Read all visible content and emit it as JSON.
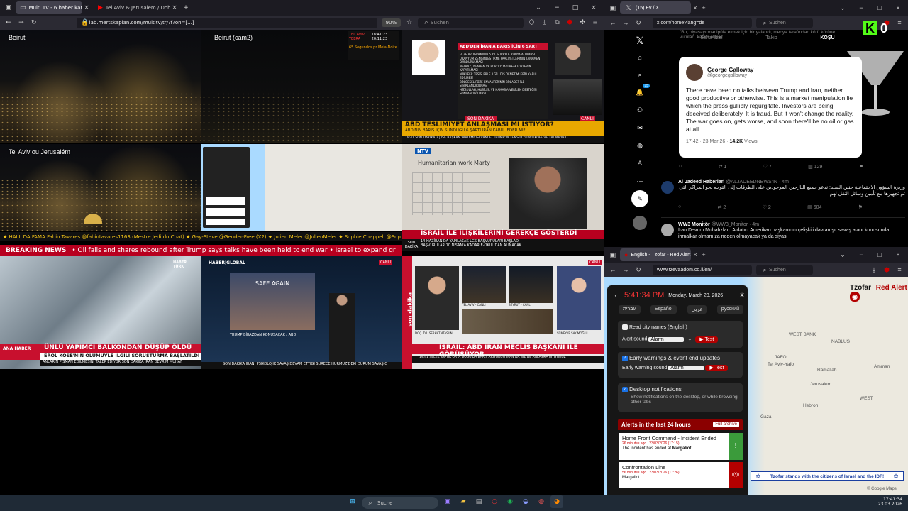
{
  "left_window": {
    "tabs": [
      {
        "label": "Multi TV - 6 haber kanalı ve"
      },
      {
        "label": "Tel Aviv & Jerusalem / Doha / ..."
      }
    ],
    "url": "lab.mertskaplan.com/multitv/tr/?f?on=[...]",
    "url_domain": "lab.mertskaplan.com",
    "zoom": "90%",
    "search_placeholder": "Suchen"
  },
  "cams": {
    "beirut": "Beirut",
    "beirut2": "Beirut (cam2)",
    "telaviv": "Tel Aviv ou Jerusalém"
  },
  "overlay_clock": {
    "row1_city": "TEL AVIV",
    "row1_time": "18:41:23",
    "row2_city": "TEERA",
    "row2_time": "20:11:23",
    "note": "65 Segundos pr Meia-Noite"
  },
  "cnn": {
    "header": "ABD'DEN İRAN'A BARIŞ İÇİN 6 ŞART",
    "items": [
      "FÜZE PROGRAMININ 5 YIL SÜREYLE ASKIYA ALINMASI",
      "URANYUM ZENGİNLEŞTİRME FAALİYETLERİNİN TAMAMEN DURDURULMASI",
      "NATANZ, İSFAHAN VE FORDO'DAKİ REAKTÖRLERİN KAPATILMASI",
      "NÜKLEER TESİSLERLE İLGİLİ DIŞ DENETİMLERİN KABUL EDİLMESİ",
      "BÖLGESEL FÜZE ENVANTERİNİN BİN ADET İLE SINIRLANDIRILMASI",
      "HİZBULLAH, HUSİLER VE HAMAS'A VERİLEN DESTEĞİN SONLANDIRILMASI"
    ],
    "son_dakika": "SON DAKİKA",
    "headline": "ABD TESLİMİYET ANLAŞMASI MI İSTİYOR?",
    "subline": "ABD'NİN BARIŞ İÇİN SUNDUĞU 6 ŞARTI İRAN KABUL EDER Mİ?",
    "canli": "CANLI",
    "ticker": "SON DAKİKA 2 | İSE BAŞKAN YARDIMCISI VANCE, TRUMP'IN TEMSİLCİSİ WITKOFF VE TRUMP'IN D",
    "time": "19:41"
  },
  "ntv": {
    "logo": "NTV",
    "banner_text": "Humanitarian work Marty",
    "headline": "İSRAİL İLE İLİŞKİLERİNİ GEREKÇE GÖSTERDİ",
    "son_dakika": "SON DAKİKA",
    "sub1": "14 HAZİRAN'DA YAPILACAK LGS BAŞVURULARI BAŞLADI",
    "sub2": "BAŞVURULAR 10 NİSAN'A KADAR E-OKUL'DAN ALINACAK",
    "time": "18:41",
    "canli": "CANLI"
  },
  "chat_ticker": "★ HALL DA FAMA  Fabio Tavares @fabiotavares1163 (Mestre Jedi do Chat)  ★  Gay-Steve @Gender-Free (X2)  ★  Julien Meler @JulienMeler  ★  Sophie Chappell @Sop",
  "breaking_news": {
    "label": "BREAKING NEWS",
    "text": "•  Oil falls and shares rebound after Trump says talks have been held to end war   •  Israel to expand gr"
  },
  "haberturk": {
    "logo": "HABER TÜRK",
    "ana_haber": "ANA HABER",
    "headline": "ÜNLÜ YAPIMCI BALKONDAN DÜŞÜP ÖLDÜ",
    "sub": "EROL KÖSE'NİN ÖLÜMÜYLE İLGİLİ SORUŞTURMA BAŞLATILDI",
    "ticker": "ANLARIN PİŞMAN EDİLMESİNİ TALEP EDİYOR   SON DAKİKA   İRAN DEVRİM MUHAF"
  },
  "haberglobal": {
    "logo": "HABER|GLOBAL",
    "sign": "SAFE AGAIN",
    "caption": "TRUMP BİRAZDAN KONUŞACAK / ABD",
    "ticker": "SON DAKİKA   İRAN: PSİKOLOJİK SAVAŞ DEVAM ETTİĞİ SÜRECE HÜRMÜZ'DEKİ DURUM SAVAŞ Ö",
    "canli": "CANLI"
  },
  "a_haber": {
    "son_dakika": "son dakika",
    "loc1": "TEL AVİV - CANLI",
    "loc2": "BEYRUT - CANLI",
    "guest1": "DOÇ. DR. SERHAT ATASUN",
    "guest2": "SÜMEYYE SAYIMOĞLU",
    "headline": "İSRAİL: ABD İRAN MECLİS BAŞKANI İLE GÖRÜŞÜYOR",
    "ticker": "19:41   ŞELEK YAPTIK   ORTA DOĞU'DA BARIŞ ARIYORUM   İRAN DA BİZ DE ANLAŞMA İSTİYORUZ",
    "canli": "CANLI"
  },
  "twitter_window": {
    "tab": "(15) Ev / X",
    "url": "x.com/home?lang=de",
    "search_placeholder": "Suchen",
    "top_tweet_text": "\"Bu, piyasayı manipüle etmek için bir yalandı, medya tarafından körü körüne yutulan, kasıtlı olarak",
    "top_tabs": [
      "Sana özel",
      "Takip",
      "KOŞU"
    ],
    "kick_logo": "K",
    "kick_count": "0",
    "quote": {
      "author": "George Galloway",
      "handle": "@georgegalloway",
      "text": "There have been no talks between Trump and Iran, neither good productive or otherwise. This is a market manipulation lie which the press gullibly regurgitate. Investors are being deceived deliberately. It is fraud. But it won't change the reality. The war goes on, gets worse, and soon there'll be no oil or gas at all.",
      "meta": "17:42 · 23 Mar 26 · ",
      "views": "14.2K",
      "views_label": " Views"
    },
    "stats1": [
      "",
      "1",
      "7",
      "129"
    ],
    "post2": {
      "author": "Al Jadeed Haberleri",
      "handle": "@ALJADEEDNEWS'IN · 4m",
      "text": "وزيرة الشؤون الاجتماعية حنين السيد: ندعو جميع النازحين الموجودين على الطرقات إلى التوجه نحو المراكز التي تم تجهيزها مع تأمين وسائل النقل لهم",
      "stats": [
        "",
        "2",
        "2",
        "604"
      ]
    },
    "post3": {
      "author": "WW3 Monitör",
      "handle": "@WW3_Monitor · 4m",
      "text": "İran Devrim Muhafızları: Aldatıcı Amerikan başkanının çelişkili davranışı, savaş alanı konusunda ihmalkar olmamıza neden olmayacak ya da siyasi"
    },
    "nav_badge": "15"
  },
  "tzofar_window": {
    "tab": "English - Tzofar - Red Alert",
    "url": "www.tzevaadom.co.il/en/",
    "search_placeholder": "Suchen",
    "time": "5:41:34 PM",
    "date": "Monday, March 23, 2026",
    "languages": [
      "עברית",
      "Español",
      "عربي",
      "русский"
    ],
    "read_city": "Read city names (English)",
    "alert_sound_label": "Alert sound",
    "alert_sound_value": "Alarm",
    "test": "Test",
    "early_warnings": "Early warnings & event end updates",
    "early_sound_label": "Early warning sound",
    "early_sound_value": "Alarm",
    "desktop_notif": "Desktop notifications",
    "desktop_desc": "Show notifications on the desktop, or while browsing other tabs",
    "alerts_header": "Alerts in the last 24 hours",
    "full_archive": "Full archive",
    "alerts": [
      {
        "title": "Home Front Command - Incident Ended",
        "meta": "26 minutes ago | 23/03/2026 (17:15)",
        "desc": "The incident has ended at ",
        "place": "Margaliot",
        "icon": "!"
      },
      {
        "title": "Confrontation Line",
        "meta": "56 minutes ago | 23/03/2026 (17:26)",
        "desc": "",
        "place": "Margaliot",
        "icon": "((•))"
      }
    ],
    "brand": "Tzofar",
    "brand2": "Red Alert",
    "banner": "Tzofar stands with the citizens of Israel and the IDF!",
    "map_labels": [
      "WEST BANK",
      "NABLUS",
      "Ramallah",
      "Amman",
      "JAFO",
      "Tel Aviv-Yafo",
      "Jerusalem",
      "Hebron",
      "Gaza",
      "WEST"
    ],
    "google": "© Google Maps"
  },
  "taskbar": {
    "search": "Suche",
    "time": "17:41:34",
    "date": "23.03.2026"
  },
  "colors": {
    "accent_red": "#c8102e",
    "x_bg": "#000000",
    "tzofar_red": "#b30000"
  }
}
